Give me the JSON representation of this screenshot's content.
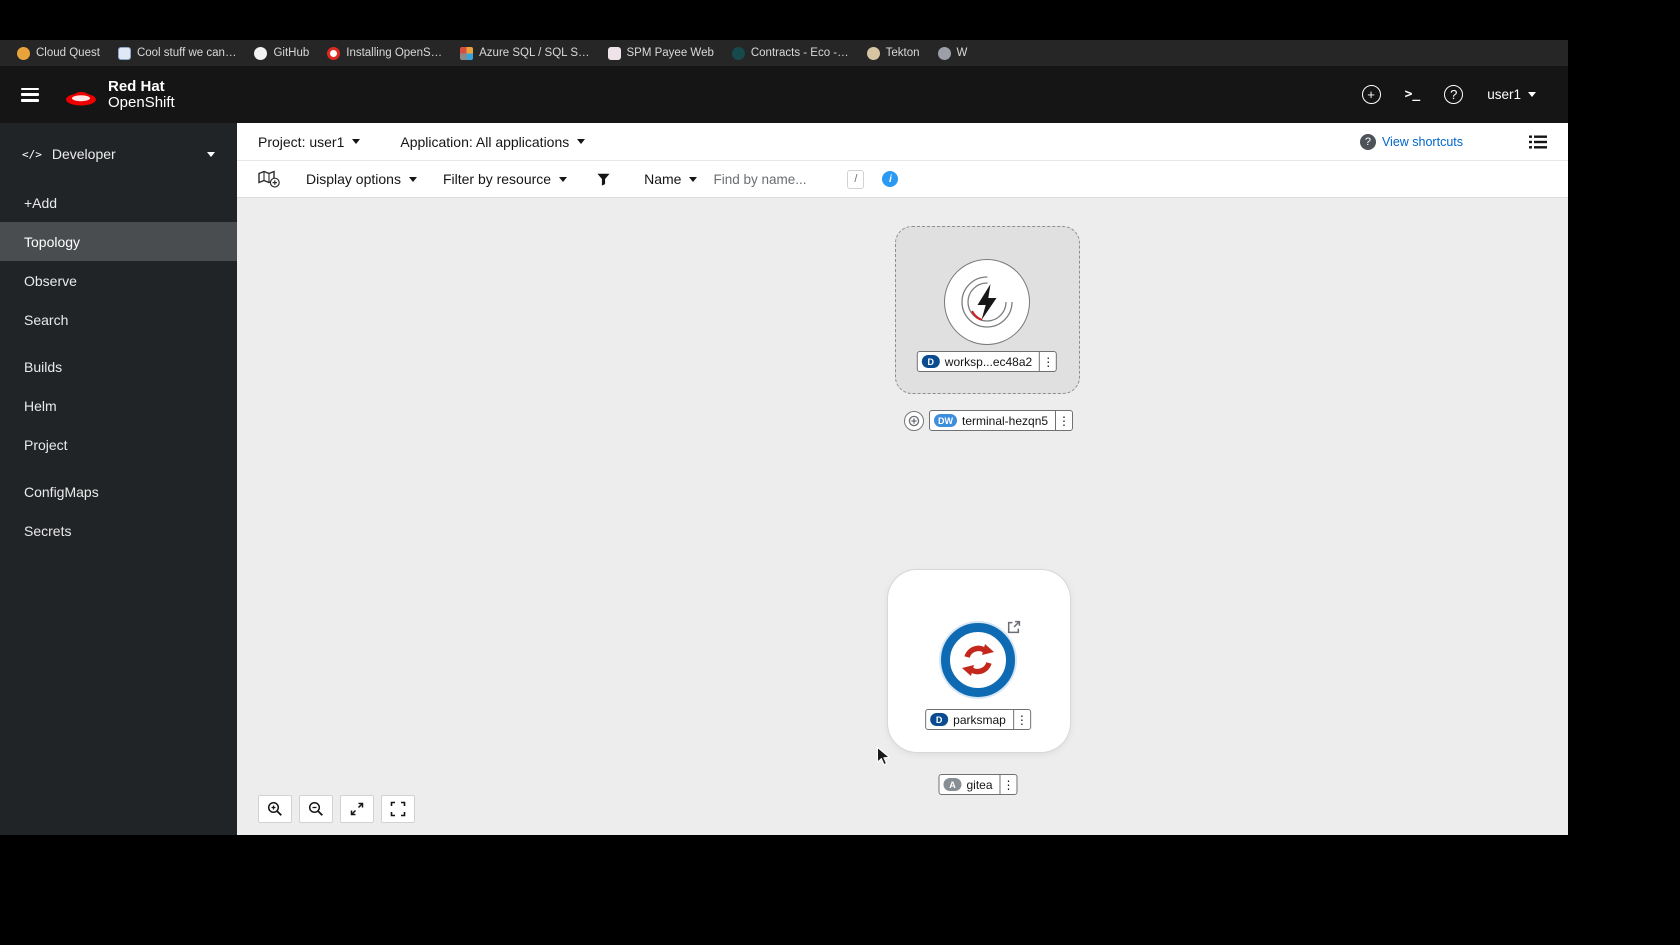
{
  "icons": {
    "kebab": "⋮",
    "plus": "+",
    "help": "?",
    "terminal_prompt": ">_",
    "code": "</>",
    "question": "?",
    "info": "i"
  },
  "bookmarks": {
    "items": [
      {
        "label": "Cloud Quest"
      },
      {
        "label": "Cool stuff we can…"
      },
      {
        "label": "GitHub"
      },
      {
        "label": "Installing OpenS…"
      },
      {
        "label": "Azure SQL / SQL S…"
      },
      {
        "label": "SPM Payee Web"
      },
      {
        "label": "Contracts - Eco -…"
      },
      {
        "label": "Tekton"
      },
      {
        "label": "W"
      }
    ]
  },
  "masthead": {
    "brand_top": "Red Hat",
    "brand_bottom": "OpenShift",
    "user": "user1"
  },
  "sidebar": {
    "perspective": "Developer",
    "items": [
      {
        "label": "+Add"
      },
      {
        "label": "Topology"
      },
      {
        "label": "Observe"
      },
      {
        "label": "Search"
      },
      {
        "label": "Builds"
      },
      {
        "label": "Helm"
      },
      {
        "label": "Project"
      },
      {
        "label": "ConfigMaps"
      },
      {
        "label": "Secrets"
      }
    ]
  },
  "context_bar": {
    "project": "Project: user1",
    "application": "Application: All applications",
    "view_shortcuts": "View shortcuts"
  },
  "toolbar": {
    "display_options": "Display options",
    "filter_by_resource": "Filter by resource",
    "name": "Name",
    "find_placeholder": "Find by name...",
    "slash": "/"
  },
  "topology": {
    "workspace": {
      "badge": "D",
      "label": "worksp...ec48a2"
    },
    "terminal": {
      "badge": "DW",
      "label": "terminal-hezqn5"
    },
    "parksmap": {
      "badge": "D",
      "label": "parksmap"
    },
    "gitea": {
      "badge": "A",
      "label": "gitea"
    }
  },
  "colors": {
    "masthead_bg": "#151515",
    "sidebar_bg": "#212427",
    "sidebar_active_bg": "#4a4d50",
    "canvas_bg": "#ededed",
    "accent_blue": "#0066cc",
    "info_blue": "#2b9af3",
    "badge_deployment": "#0b4b8f",
    "badge_devworkspace": "#3e8ede",
    "badge_application": "#888f94",
    "node_red": "#c4281c",
    "node_ring_blue": "#0e6bb3",
    "redhat_red": "#ee0000"
  }
}
